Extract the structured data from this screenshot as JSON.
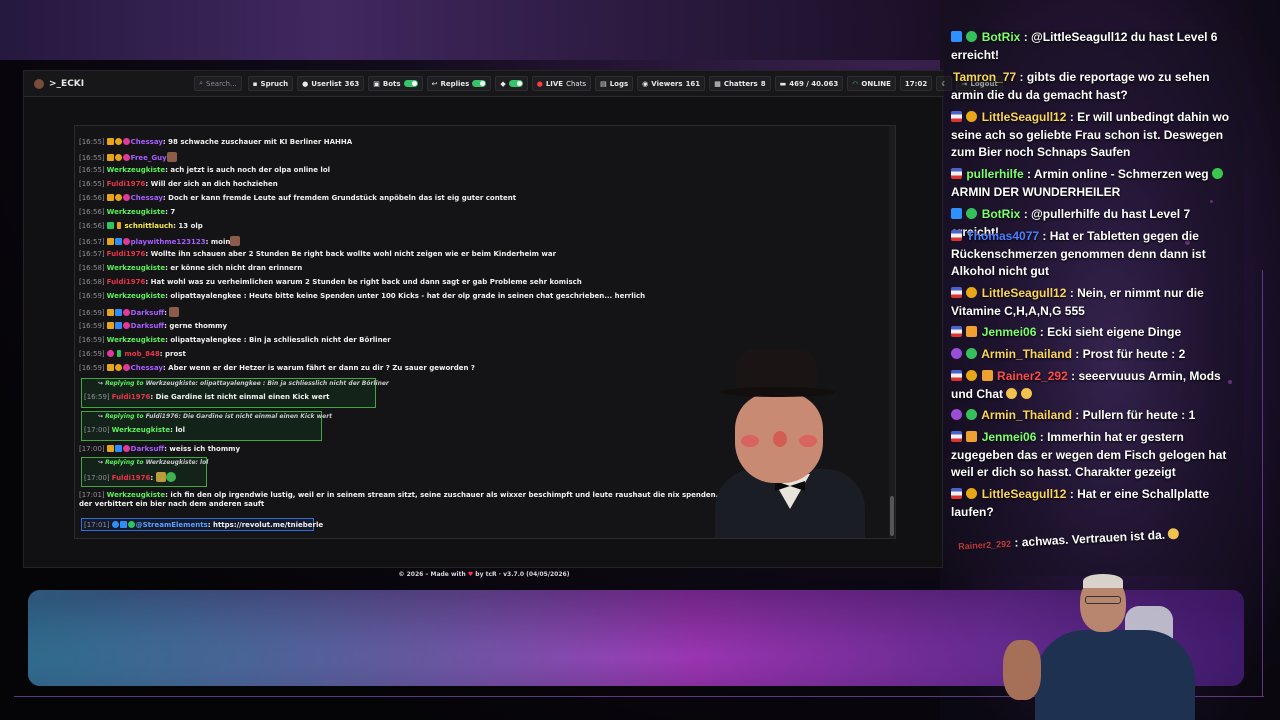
{
  "topbar": {
    "brand": ">_ECKI",
    "search_placeholder": "Search...",
    "spruch": "Spruch",
    "userlist_label": "Userlist",
    "userlist_count": "363",
    "bots": "Bots",
    "replies": "Replies",
    "live": "LIVE",
    "chats": "Chats",
    "logs": "Logs",
    "viewers_label": "Viewers",
    "viewers_count": "161",
    "chatters_label": "Chatters",
    "chatters_count": "8",
    "messages": "469 / 40.063",
    "online": "ONLINE",
    "time": "17:02",
    "logout": "Logout"
  },
  "chat": {
    "messages": [
      {
        "ts": "[16:55]",
        "user": "Chessay",
        "text": "98 schwache zuschauer mit KI Berliner HAHHA"
      },
      {
        "ts": "[16:55]",
        "user": "Free_Guy",
        "text": ""
      },
      {
        "ts": "[16:55]",
        "user": "Werkzeugkiste",
        "text": "ach jetzt is auch noch der olpa online lol"
      },
      {
        "ts": "[16:55]",
        "user": "Fuldi1976",
        "text": "Will der sich an dich hochziehen"
      },
      {
        "ts": "[16:56]",
        "user": "Chessay",
        "text": "Doch er kann fremde Leute auf fremdem Grundstück anpöbeln das ist eig guter content"
      },
      {
        "ts": "[16:56]",
        "user": "Werkzeugkiste",
        "text": "7"
      },
      {
        "ts": "[16:56]",
        "user": "schnittlauch",
        "text": "13 olp"
      },
      {
        "ts": "[16:57]",
        "user": "playwithme123123",
        "text": "moin"
      },
      {
        "ts": "[16:57]",
        "user": "Fuldi1976",
        "text": "Wollte ihn schauen aber 2 Stunden Be right back wollte wohl nicht zeigen wie er beim Kinderheim war"
      },
      {
        "ts": "[16:58]",
        "user": "Werkzeugkiste",
        "text": "er könne sich nicht dran erinnern"
      },
      {
        "ts": "[16:58]",
        "user": "Fuldi1976",
        "text": "Hat wohl was zu verheimlichen warum 2 Stunden be right back und dann sagt er gab Probleme sehr komisch"
      },
      {
        "ts": "[16:59]",
        "user": "Werkzeugkiste",
        "text": "olipattayalengkee : Heute bitte keine Spenden unter 100 Kicks - hat der olp grade in seinen chat geschrieben... herrlich"
      },
      {
        "ts": "[16:59]",
        "user": "Darksuff",
        "text": ""
      },
      {
        "ts": "[16:59]",
        "user": "Darksuff",
        "text": "gerne thommy"
      },
      {
        "ts": "[16:59]",
        "user": "Werkzeugkiste",
        "text": "olipattayalengkee : Bin ja schliesslich nicht der Börliner"
      },
      {
        "ts": "[16:59]",
        "user": "mob_848",
        "text": "prost"
      },
      {
        "ts": "[16:59]",
        "user": "Chessay",
        "text": "Aber wenn er der Hetzer is warum fährt er dann zu dir ? Zu sauer geworden ?"
      }
    ],
    "replies": [
      {
        "label": "Replying to",
        "target": "Werkzeugkiste:",
        "quote": "olipattayalengkee : Bin ja schliesslich nicht der Börliner",
        "ts": "[16:59]",
        "user": "Fuldi1976",
        "text": "Die Gardine ist nicht einmal einen Kick wert"
      },
      {
        "label": "Replying to",
        "target": "Fuldi1976:",
        "quote": "Die Gardine ist nicht einmal einen Kick wert",
        "ts": "[17:00]",
        "user": "Werkzeugkiste",
        "text": "lol"
      },
      {
        "label": "Replying to",
        "target": "Werkzeugkiste:",
        "quote": "lol",
        "ts": "[17:00]",
        "user": "Fuldi1976",
        "text": ""
      }
    ],
    "between": {
      "ts": "[17:00]",
      "user": "Darksuff",
      "text": "weiss ich thommy"
    },
    "long": {
      "ts": "[17:01]",
      "user": "Werkzeugkiste",
      "text": "ich fin den olp irgendwie lustig, weil er in seinem stream sitzt, seine zuschauer als wixxer beschimpft und leute raushaut die nix spenden... so ein ghriesgrämiger alter mann der verbittert ein bier nach dem anderen sauft"
    },
    "se": {
      "ts": "[17:01]",
      "user": "@StreamElements",
      "text": "https://revolut.me/tnieberle"
    }
  },
  "footer": {
    "prefix": "© 2026 – Made with",
    "by": "by tcR",
    "version": "· v3.7.0 (04/05/2026)"
  },
  "side_chat": [
    {
      "user": "BotRix",
      "sep": ":",
      "text": "@LittleSeagull12 du hast Level 6 erreicht!",
      "color": "n-green"
    },
    {
      "user": "Tamron_77",
      "sep": ":",
      "text": "gibts die reportage wo zu sehen armin die du da gemacht hast?",
      "color": "n-yellow"
    },
    {
      "user": "LittleSeagull12",
      "sep": ":",
      "text": "Er will unbedingt dahin wo seine ach so geliebte Frau schon ist. Deswegen zum Bier noch Schnaps Saufen",
      "color": "n-yellow"
    },
    {
      "user": "pullerhilfe",
      "sep": ":",
      "text": "Armin online - Schmerzen weg",
      "text2": "ARMIN DER WUNDERHEILER",
      "color": "n-green"
    },
    {
      "user": "BotRix",
      "sep": ":",
      "text": "@pullerhilfe du hast Level 7 erreicht!",
      "color": "n-green"
    },
    {
      "user": "Thomas4077",
      "sep": ":",
      "text": "Hat er Tabletten gegen die Rückenschmerzen genommen denn dann ist Alkohol nicht gut",
      "color": "n-blue"
    },
    {
      "user": "LittleSeagull12",
      "sep": ":",
      "text": "Nein, er nimmt nur die Vitamine C,H,A,N,G 555",
      "color": "n-yellow"
    },
    {
      "user": "Jenmei06",
      "sep": ":",
      "text": "Ecki sieht eigene Dinge",
      "color": "n-green"
    },
    {
      "user": "Armin_Thailand",
      "sep": ":",
      "text": "Prost für heute : 2",
      "color": "n-yellow"
    },
    {
      "user": "Rainer2_292",
      "sep": ":",
      "text": "seeervuuus Armin, Mods und Chat",
      "color": "n-red"
    },
    {
      "user": "Armin_Thailand",
      "sep": ":",
      "text": "Pullern für heute : 1",
      "color": "n-yellow"
    },
    {
      "user": "Jenmei06",
      "sep": ":",
      "text": "Immerhin hat er gestern zugegeben das er wegen dem Fisch gelogen hat weil er dich so hasst. Charakter gezeigt",
      "color": "n-green"
    },
    {
      "user": "LittleSeagull12",
      "sep": ":",
      "text": "Hat er eine Schallplatte laufen?",
      "color": "n-yellow"
    },
    {
      "user": "Rainer2_292",
      "sep": ":",
      "text": "achwas. Vertrauen ist da.",
      "color": "n-red"
    }
  ]
}
